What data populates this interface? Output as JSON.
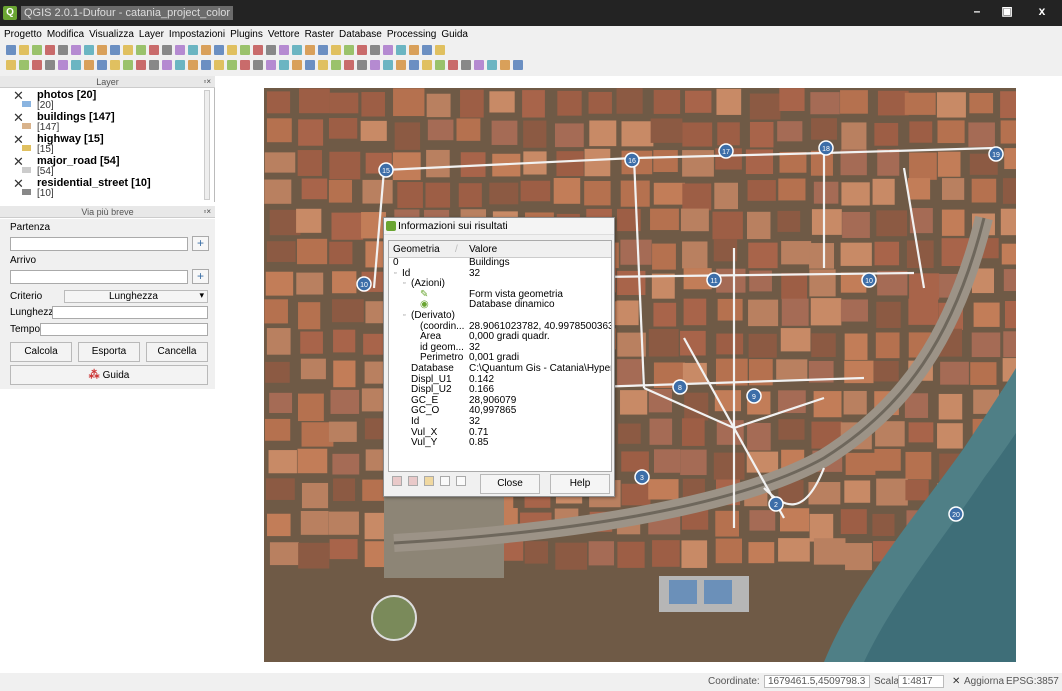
{
  "window": {
    "title": "QGIS 2.0.1-Dufour - catania_project_color",
    "logo_letter": "Q",
    "controls": {
      "minimize": "–",
      "maximize": "▣",
      "close": "x"
    }
  },
  "menu": [
    "Progetto",
    "Modifica",
    "Visualizza",
    "Layer",
    "Impostazioni",
    "Plugins",
    "Vettore",
    "Raster",
    "Database",
    "Processing",
    "Guida"
  ],
  "layers_panel": {
    "title": "Layer",
    "layers": [
      {
        "name": "photos [20]",
        "count": "[20]",
        "symbol_color": "#8ab4e0"
      },
      {
        "name": "buildings [147]",
        "count": "[147]",
        "symbol_color": "#d9b38c"
      },
      {
        "name": "highway [15]",
        "count": "[15]",
        "symbol_color": "#e0c060"
      },
      {
        "name": "major_road [54]",
        "count": "[54]",
        "symbol_color": "#cccccc"
      },
      {
        "name": "residential_street [10]",
        "count": "[10]",
        "symbol_color": "#888888"
      }
    ]
  },
  "shortest_path": {
    "title": "Via più breve",
    "start_label": "Partenza",
    "end_label": "Arrivo",
    "criterion_label": "Criterio",
    "criterion_value": "Lunghezza",
    "length_label": "Lunghezza",
    "time_label": "Tempo",
    "calc_button": "Calcola",
    "export_button": "Esporta",
    "cancel_button": "Cancella",
    "help_button": "Guida",
    "add_icon": "+"
  },
  "identify_dialog": {
    "title": "Informazioni sui risultati",
    "columns": [
      "Geometria",
      "Valore"
    ],
    "rows": [
      {
        "key": "0",
        "value": "Buildings",
        "indent": 0,
        "expander": "▫"
      },
      {
        "key": "Id",
        "value": "32",
        "indent": 1,
        "expander": "▫"
      },
      {
        "key": "(Azioni)",
        "value": "",
        "indent": 2,
        "expander": "▫"
      },
      {
        "key": "",
        "value": "Form vista geometria",
        "indent": 3,
        "icon": "pencil-icon"
      },
      {
        "key": "",
        "value": "Database dinamico",
        "indent": 3,
        "icon": "db-icon"
      },
      {
        "key": "(Derivato)",
        "value": "",
        "indent": 2,
        "expander": "▫"
      },
      {
        "key": "(coordin...",
        "value": "28.9061023782, 40.9978500363",
        "indent": 3
      },
      {
        "key": "Area",
        "value": "0,000 gradi quadr.",
        "indent": 3
      },
      {
        "key": "id geom...",
        "value": "32",
        "indent": 3
      },
      {
        "key": "Perimetro",
        "value": "0,001 gradi",
        "indent": 3
      },
      {
        "key": "Database",
        "value": "C:\\Quantum Gis - Catania\\Hyperl...",
        "indent": 2
      },
      {
        "key": "Displ_U1",
        "value": "0.142",
        "indent": 2
      },
      {
        "key": "Displ_U2",
        "value": "0.166",
        "indent": 2
      },
      {
        "key": "GC_E",
        "value": "28,906079",
        "indent": 2
      },
      {
        "key": "GC_O",
        "value": "40,997865",
        "indent": 2
      },
      {
        "key": "Id",
        "value": "32",
        "indent": 2
      },
      {
        "key": "Vul_X",
        "value": "0.71",
        "indent": 2
      },
      {
        "key": "Vul_Y",
        "value": "0.85",
        "indent": 2
      }
    ],
    "close_button": "Close",
    "help_button": "Help"
  },
  "map": {
    "markers": [
      "15",
      "16",
      "17",
      "18",
      "19",
      "10",
      "11",
      "10",
      "8",
      "9",
      "3",
      "2",
      "1",
      "20"
    ]
  },
  "statusbar": {
    "coord_label": "Coordinate:",
    "coord_value": "1679461.5,4509798.3",
    "scale_label": "Scala",
    "scale_value": "1:4817",
    "refresh_label": "Aggiorna",
    "epsg": "EPSG:3857"
  }
}
